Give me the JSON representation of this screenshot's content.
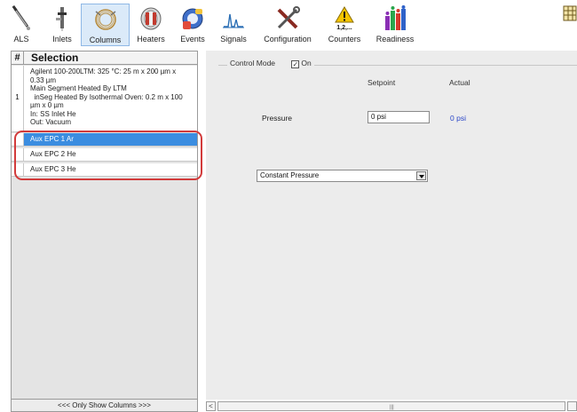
{
  "toolbar": {
    "items": [
      {
        "label": "ALS",
        "icon": "injector-icon"
      },
      {
        "label": "Inlets",
        "icon": "inlet-icon"
      },
      {
        "label": "Columns",
        "icon": "column-coil-icon"
      },
      {
        "label": "Heaters",
        "icon": "heater-icon"
      },
      {
        "label": "Events",
        "icon": "events-icon"
      },
      {
        "label": "Signals",
        "icon": "signal-peaks-icon"
      },
      {
        "label": "Configuration",
        "icon": "wrench-screwdriver-icon"
      },
      {
        "label": "Counters",
        "icon": "warning-counter-icon",
        "badge": "1,2,..."
      },
      {
        "label": "Readiness",
        "icon": "readiness-bars-icon"
      }
    ],
    "active": "Columns"
  },
  "left_panel": {
    "header_number": "#",
    "header_selection": "Selection",
    "rows": [
      {
        "number": "1",
        "lines": [
          "Agilent 100-200LTM: 325 °C: 25 m x 200 µm x",
          "0.33 µm",
          "Main Segment Heated By LTM",
          "  inSeg Heated By Isothermal Oven: 0.2 m x 100",
          "µm x 0 µm",
          "In: SS Inlet He",
          "Out: Vacuum"
        ]
      },
      {
        "number": "",
        "text": "Aux EPC 1 Ar"
      },
      {
        "number": "",
        "text": "Aux EPC 2 He"
      },
      {
        "number": "",
        "text": "Aux EPC 3 He"
      }
    ],
    "footer": "<<< Only Show Columns >>>"
  },
  "right_panel": {
    "group_label": "Control Mode",
    "on_checked": true,
    "on_label": "On",
    "setpoint_header": "Setpoint",
    "actual_header": "Actual",
    "pressure_label": "Pressure",
    "pressure_setpoint": "0 psi",
    "pressure_actual": "0 psi",
    "mode_selected": "Constant Pressure"
  },
  "colors": {
    "selection": "#3b8de0",
    "highlight": "#d23b3b",
    "actual_value": "#2a46c8"
  }
}
